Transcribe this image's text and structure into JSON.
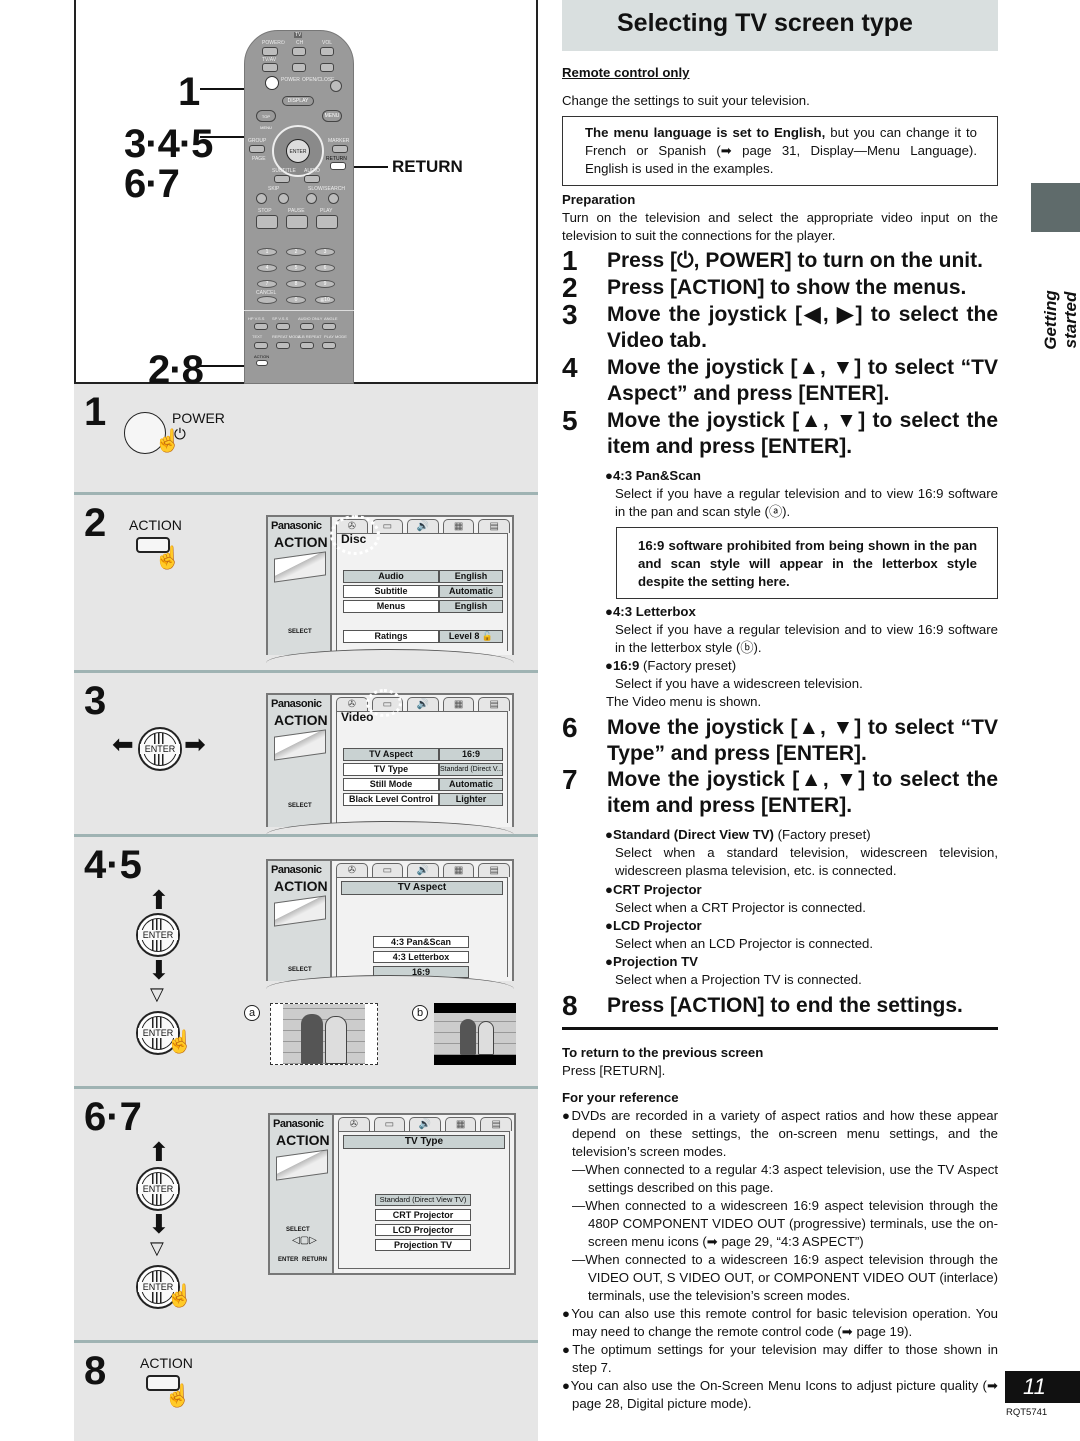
{
  "header": {
    "title": "Selecting TV screen type"
  },
  "side": {
    "section_label": "Getting started",
    "tab_color": "#5f6b6b"
  },
  "footer": {
    "page_number": "11",
    "doc_code": "RQT5741"
  },
  "remote_figure": {
    "callouts": [
      "1",
      "3·4·5",
      "6·7",
      "2·8"
    ],
    "return_label": "RETURN",
    "labels": {
      "tv": "TV",
      "power_tv": "POWER⏻",
      "ch": "CH",
      "vol": "VOL",
      "tv_av": "TV/AV",
      "power": "POWER",
      "open_close": "OPEN/CLOSE",
      "display": "DISPLAY",
      "top_menu": "TOP MENU",
      "menu": "MENU",
      "direct_navigator": "DIRECT NAVIGATOR",
      "play_list": "PLAY LIST",
      "group": "GROUP",
      "marker": "MARKER",
      "page": "PAGE",
      "return": "RETURN",
      "enter": "ENTER",
      "subtitle": "SUBTITLE",
      "audio": "AUDIO",
      "skip": "SKIP",
      "slow_search": "SLOW/SEARCH",
      "stop": "STOP",
      "pause": "PAUSE",
      "play": "PLAY",
      "cancel": "CANCEL",
      "numbers": [
        "1",
        "2",
        "3",
        "4",
        "5",
        "6",
        "7",
        "8",
        "9",
        "0",
        "≧10"
      ],
      "hp_vss": "HP V.S.S",
      "sp_vss": "SP V.S.S",
      "audio_only": "AUDIO ONLY",
      "angle": "ANGLE",
      "text": "TEXT",
      "repeat_mode": "REPEAT MODE",
      "ab_repeat": "A-B REPEAT",
      "play_mode": "PLAY MODE",
      "action": "ACTION"
    }
  },
  "steps_left": {
    "s1": {
      "num": "1",
      "button": "POWER"
    },
    "s2": {
      "num": "2",
      "button": "ACTION"
    },
    "s3": {
      "num": "3",
      "button": "ENTER"
    },
    "s45": {
      "num": "4·5",
      "button": "ENTER"
    },
    "s67": {
      "num": "6·7",
      "button": "ENTER"
    },
    "s8": {
      "num": "8",
      "button": "ACTION"
    }
  },
  "osd": {
    "brand": "Panasonic",
    "action": "ACTION",
    "select": "SELECT",
    "enter": "ENTER",
    "return": "RETURN",
    "disc_menu": {
      "tab": "Disc",
      "rows": [
        {
          "key": "Audio",
          "value": "English"
        },
        {
          "key": "Subtitle",
          "value": "Automatic"
        },
        {
          "key": "Menus",
          "value": "English"
        },
        {
          "key": "Ratings",
          "value": "Level 8 🔓"
        }
      ]
    },
    "video_menu": {
      "tab": "Video",
      "rows": [
        {
          "key": "TV Aspect",
          "value": "16:9"
        },
        {
          "key": "TV Type",
          "value": "Standard (Direct V..."
        },
        {
          "key": "Still Mode",
          "value": "Automatic"
        },
        {
          "key": "Black Level Control",
          "value": "Lighter"
        }
      ]
    },
    "aspect_menu": {
      "title": "TV Aspect",
      "options": [
        "4:3 Pan&Scan",
        "4:3 Letterbox",
        "16:9"
      ]
    },
    "type_menu": {
      "title": "TV Type",
      "options": [
        "Standard (Direct View TV)",
        "CRT Projector",
        "LCD Projector",
        "Projection TV"
      ]
    }
  },
  "illustrations": {
    "a": "a",
    "b": "b"
  },
  "content": {
    "remote_only": "Remote control only",
    "intro": "Change the settings to suit your television.",
    "note_box": {
      "bold": "The menu language is set to English,",
      "rest": " but you can change it to French or Spanish (➡ page 31, Display—Menu Language). English is used in the examples."
    },
    "preparation": {
      "heading": "Preparation",
      "text": "Turn on the television and select the appropriate video input on the television to suit the connections for the player."
    },
    "steps": [
      {
        "num": "1",
        "text": "Press [⏻, POWER] to turn on the unit."
      },
      {
        "num": "2",
        "text": "Press [ACTION] to show the menus."
      },
      {
        "num": "3",
        "text": "Move the joystick [◀, ▶] to select the Video tab."
      },
      {
        "num": "4",
        "text": "Move the joystick [▲, ▼] to select “TV Aspect” and press [ENTER]."
      },
      {
        "num": "5",
        "text": "Move the joystick [▲, ▼] to select the item and press [ENTER]."
      },
      {
        "num": "6",
        "text": "Move the joystick [▲, ▼] to select “TV Type” and press [ENTER]."
      },
      {
        "num": "7",
        "text": "Move the joystick [▲, ▼] to select the item and press [ENTER]."
      },
      {
        "num": "8",
        "text": "Press [ACTION] to end the settings."
      }
    ],
    "aspect_options": [
      {
        "title": "●4:3 Pan&Scan",
        "note": "",
        "desc": "Select if you have a regular television and to view 16:9 software in the pan and scan style (ⓐ)."
      },
      {
        "title": "●4:3 Letterbox",
        "note": "",
        "desc": "Select if you have a regular television and to view 16:9 software in the letterbox style (ⓑ)."
      },
      {
        "title": "●16:9",
        "note": " (Factory preset)",
        "desc": "Select if you have a widescreen television."
      }
    ],
    "warning_box": "16:9 software prohibited from being shown in the pan and scan style will appear in the letterbox style despite the setting here.",
    "video_menu_shown": "The Video menu is shown.",
    "type_options": [
      {
        "title": "●Standard (Direct View TV)",
        "note": " (Factory preset)",
        "desc": "Select when a standard television, widescreen television, widescreen plasma television, etc. is connected."
      },
      {
        "title": "●CRT Projector",
        "note": "",
        "desc": "Select when a CRT Projector is connected."
      },
      {
        "title": "●LCD Projector",
        "note": "",
        "desc": "Select when an LCD Projector is connected."
      },
      {
        "title": "●Projection TV",
        "note": "",
        "desc": "Select when a Projection TV is connected."
      }
    ],
    "return_section": {
      "heading": "To return to the previous screen",
      "text": "Press [RETURN]."
    },
    "reference": {
      "heading": "For your reference",
      "items": [
        "●DVDs are recorded in a variety of aspect ratios and how these appear depend on these settings, the on-screen menu settings, and the television’s screen modes.",
        "—When connected to a regular 4:3 aspect television, use the TV Aspect settings described on this page.",
        "—When connected to a widescreen 16:9 aspect television through the 480P COMPONENT VIDEO OUT (progressive) terminals, use the on-screen menu icons (➡ page 29, “4:3 ASPECT”)",
        "—When connected to a widescreen 16:9 aspect television through the VIDEO OUT, S VIDEO OUT, or COMPONENT VIDEO OUT (interlace) terminals, use the television’s screen modes.",
        "●You can also use this remote control for basic television operation. You may need to change the remote control code (➡ page 19).",
        "●The optimum settings for your television may differ to those shown in step 7.",
        "●You can also use the On-Screen Menu Icons to adjust picture quality (➡ page 28, Digital picture mode)."
      ]
    }
  }
}
